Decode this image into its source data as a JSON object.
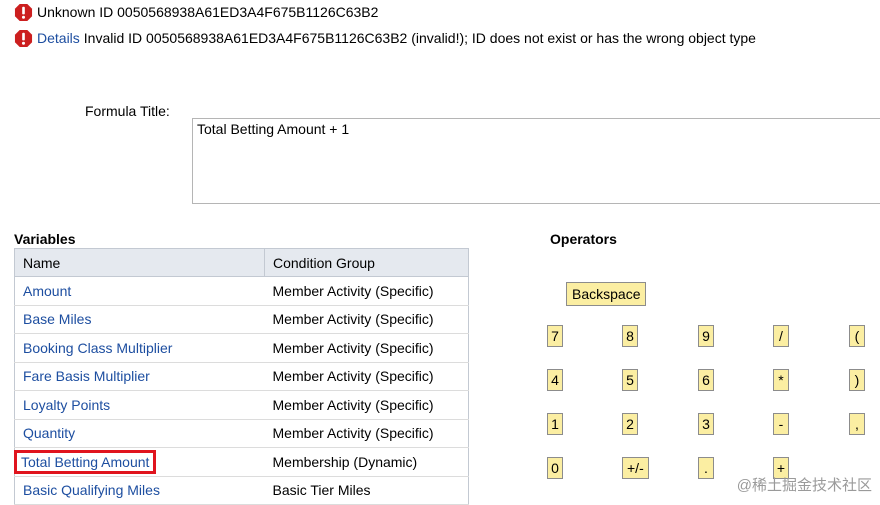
{
  "messages": [
    {
      "text": "Unknown ID 0050568938A61ED3A4F675B1126C63B2"
    },
    {
      "link": "Details",
      "text": "Invalid ID 0050568938A61ED3A4F675B1126C63B2 (invalid!); ID does not exist or has the wrong object type"
    }
  ],
  "formula": {
    "label": "Formula Title:",
    "value": "Total Betting Amount + 1"
  },
  "variables": {
    "title": "Variables",
    "headers": {
      "name": "Name",
      "group": "Condition Group"
    },
    "rows": [
      {
        "name": "Amount",
        "group": "Member Activity (Specific)"
      },
      {
        "name": "Base Miles",
        "group": "Member Activity (Specific)"
      },
      {
        "name": "Booking Class Multiplier",
        "group": "Member Activity (Specific)"
      },
      {
        "name": "Fare Basis Multiplier",
        "group": "Member Activity (Specific)"
      },
      {
        "name": "Loyalty Points",
        "group": "Member Activity (Specific)"
      },
      {
        "name": "Quantity",
        "group": "Member Activity (Specific)"
      },
      {
        "name": "Total Betting Amount",
        "group": "Membership (Dynamic)"
      },
      {
        "name": "Basic Qualifying Miles",
        "group": "Basic Tier Miles"
      }
    ]
  },
  "operators": {
    "title": "Operators",
    "backspace": "Backspace",
    "keys": [
      "7",
      "8",
      "9",
      "/",
      "(",
      "4",
      "5",
      "6",
      "*",
      ")",
      "1",
      "2",
      "3",
      "-",
      ",",
      "0",
      "+/-",
      ".",
      "+"
    ]
  },
  "watermark": "@稀土掘金技术社区",
  "colors": {
    "link": "#1d4ea0",
    "button": "#fbeea2",
    "highlight": "#e0141e",
    "error": "#cc1f1f"
  }
}
